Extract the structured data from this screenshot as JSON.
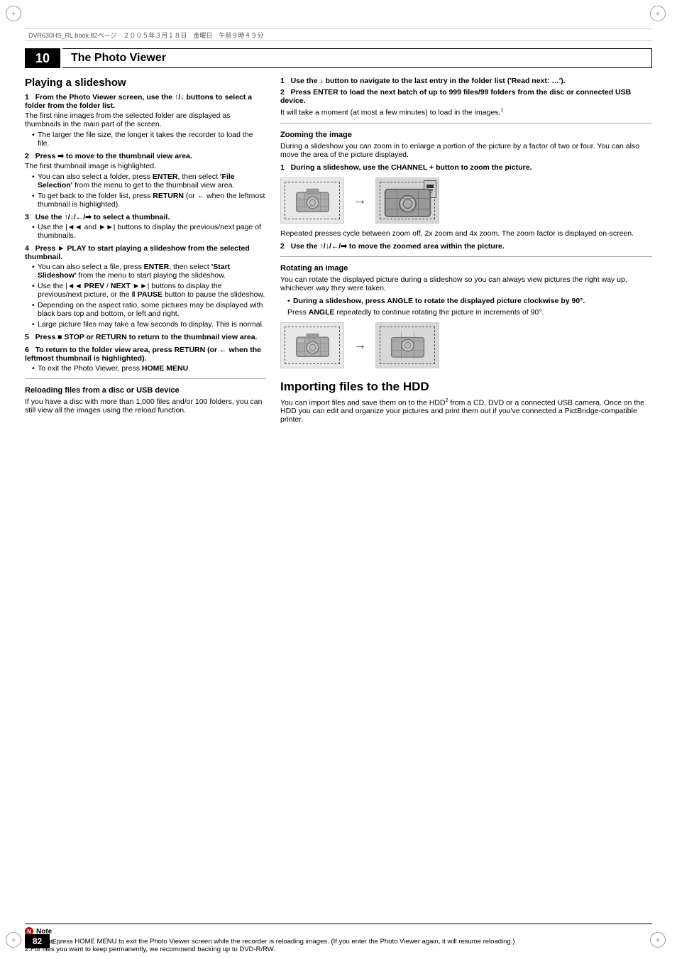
{
  "header": {
    "file_info": "DVR630HS_RL.book  82ページ　２００５年３月１８日　金曜日　午前９時４９分"
  },
  "chapter": {
    "number": "10",
    "title": "The Photo Viewer"
  },
  "left_column": {
    "section_title": "Playing a slideshow",
    "step1_header": "1   From the Photo Viewer screen, use the ↑/↓ buttons to select a folder from the folder list.",
    "step1_body": "The first nine images from the selected folder are displayed as thumbnails in the main part of the screen.",
    "step1_bullets": [
      "The larger the file size, the longer it takes the recorder to load the file."
    ],
    "step2_header": "2   Press ➡ to move to the thumbnail view area.",
    "step2_body": "The first thumbnail image is highlighted.",
    "step2_bullets": [
      "You can also select a folder, press ENTER, then select 'File Selection' from the menu to get to the thumbnail view area.",
      "To get back to the folder list, press RETURN (or ← when the leftmost thumbnail is highlighted)."
    ],
    "step3_header": "3   Use the ↑/↓/←/➡ to select a thumbnail.",
    "step3_bullets": [
      "Use the |◄◄ and ►►| buttons to display the previous/next page of thumbnails."
    ],
    "step4_header": "4   Press ► PLAY to start playing a slideshow from the selected thumbnail.",
    "step4_bullets": [
      "You can also select a file, press ENTER, then select 'Start Slideshow' from the menu to start playing the slideshow.",
      "Use the |◄◄ PREV / NEXT ►►| buttons to display the previous/next picture, or the ‖ PAUSE button to pause the slideshow.",
      "Depending on the aspect ratio, some pictures may be displayed with black bars top and bottom, or left and right.",
      "Large picture files may take a few seconds to display. This is normal."
    ],
    "step5_header": "5   Press ■ STOP or RETURN to return to the thumbnail view area.",
    "step6_header": "6   To return to the folder view area, press RETURN (or ← when the leftmost thumbnail is highlighted).",
    "step6_bullet": "To exit the Photo Viewer, press HOME MENU.",
    "reload_title": "Reloading files from a disc or USB device",
    "reload_body": "If you have a disc with more than 1,000 files and/or 100 folders, you can still view all the images using the reload function."
  },
  "right_column": {
    "right_step1_bold": "1   Use the ↓ button to navigate to the last entry in the folder list ('Read next: …').",
    "right_step2_bold": "2   Press ENTER to load the next batch of up to 999 files/99 folders from the disc or connected USB device.",
    "right_step2_body": "It will take a moment (at most a few minutes) to load in the images.",
    "right_step2_note": "1",
    "zoom_title": "Zooming the image",
    "zoom_body": "During a slideshow you can zoom in to enlarge a portion of the picture by a factor of two or four. You can also move the area of the picture displayed.",
    "zoom_step1_bold": "1   During a slideshow, use the CHANNEL + button to zoom the picture.",
    "zoom_note": "Repeated presses cycle between zoom off, 2x zoom and 4x zoom. The zoom factor is displayed on-screen.",
    "zoom_step2_bold": "2   Use the ↑/↓/←/➡ to move the zoomed area within the picture.",
    "rotate_title": "Rotating an image",
    "rotate_body": "You can rotate the displayed picture during a slideshow so you can always view pictures the right way up, whichever way they were taken.",
    "rotate_bullet_bold": "During a slideshow, press ANGLE to rotate the displayed picture clockwise by 90°.",
    "rotate_bullet_body": "Press ANGLE repeatedly to continue rotating the picture in increments of 90°.",
    "import_title": "Importing files to the HDD",
    "import_body": "You can import files and save them on to the HDD",
    "import_sup": "2",
    "import_body2": " from a CD, DVD or a connected USB camera. Once on the HDD you can edit and organize your pictures and print them out if you've connected a PictBridge-compatible printer."
  },
  "notes": {
    "title": "Note",
    "note1": "1.You can press HOME MENU to exit the Photo Viewer screen while the recorder is reloading images. (If you enter the Photo Viewer again, it will resume reloading.)",
    "note2": "2.For files you want to keep permanently, we recommend backing up to DVD-R/RW."
  },
  "page": {
    "number": "82",
    "lang": "En"
  }
}
